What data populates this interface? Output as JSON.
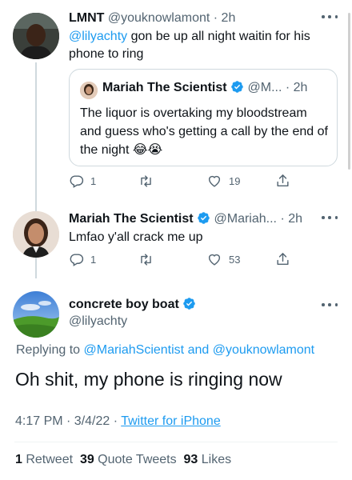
{
  "tweet1": {
    "display_name": "LMNT",
    "handle": "@youknowlamont",
    "time": "· 2h",
    "mention": "@lilyachty",
    "text": " gon be up all night waitin for his phone to ring",
    "reply_count": "1",
    "retweet_count": "",
    "like_count": "19"
  },
  "quote": {
    "display_name": "Mariah The Scientist",
    "handle": "@M...",
    "time": "· 2h",
    "text": "The liquor is overtaking my bloodstream and guess who's getting a call by the end of the night 😂😭"
  },
  "tweet2": {
    "display_name": "Mariah The Scientist",
    "handle": "@Mariah...",
    "time": "· 2h",
    "text": "Lmfao y'all crack me up",
    "reply_count": "1",
    "like_count": "53"
  },
  "main": {
    "display_name": "concrete boy boat",
    "handle": "@lilyachty",
    "replying_prefix": "Replying to ",
    "replying_targets": "@MariahScientist and @youknowlamont",
    "text": "Oh shit, my phone is ringing now",
    "timestamp": "4:17 PM · 3/4/22 · ",
    "source": "Twitter for iPhone",
    "retweets_count": "1",
    "retweets_label": " Retweet",
    "quotes_count": "39",
    "quotes_label": " Quote Tweets",
    "likes_count": "93",
    "likes_label": " Likes"
  },
  "colors": {
    "accent": "#1d9bf0",
    "text": "#0f1419",
    "secondary": "#536471",
    "border": "#cfd9de"
  }
}
